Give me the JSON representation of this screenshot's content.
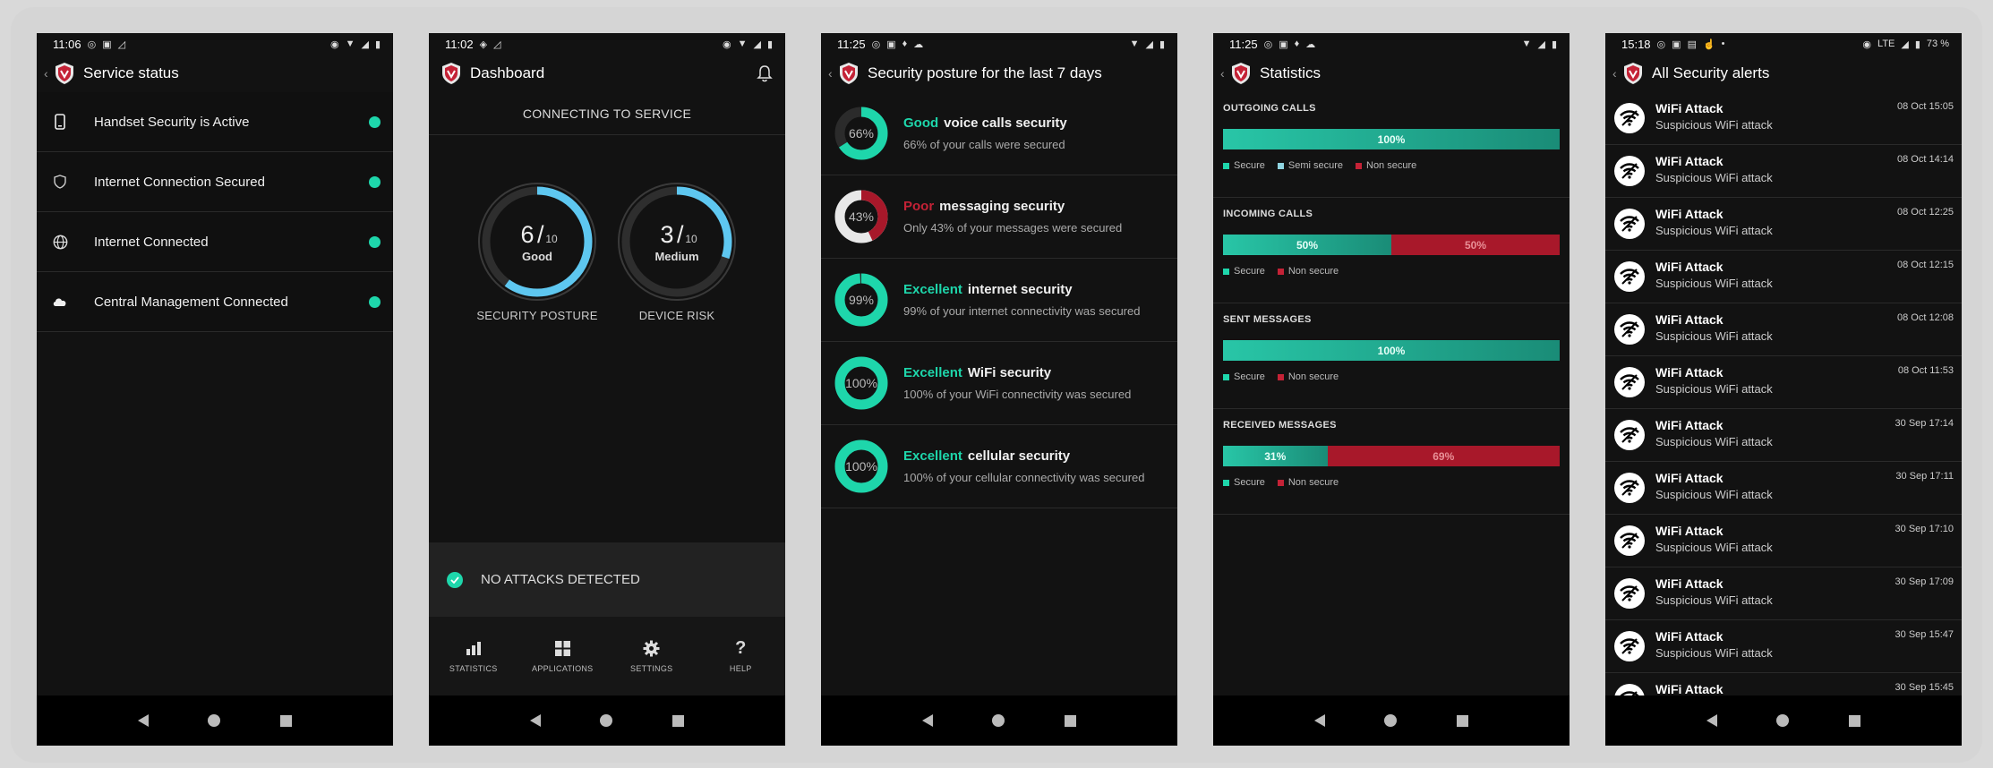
{
  "colors": {
    "accent": "#1ed6ab",
    "poor": "#a8182a",
    "ring_blue": "#5ec7f0"
  },
  "phones": [
    {
      "status": {
        "time": "11:06"
      },
      "title": "Service status",
      "items": [
        {
          "icon": "phone-icon",
          "label": "Handset Security is Active"
        },
        {
          "icon": "shield-icon",
          "label": "Internet Connection Secured"
        },
        {
          "icon": "globe-icon",
          "label": "Internet Connected"
        },
        {
          "icon": "cloud-icon",
          "label": "Central Management Connected"
        }
      ]
    },
    {
      "status": {
        "time": "11:02"
      },
      "title": "Dashboard",
      "connecting": "CONNECTING TO SERVICE",
      "gauges": [
        {
          "score": "6",
          "denom": "10",
          "rating": "Good",
          "label": "SECURITY POSTURE",
          "fraction": 0.6
        },
        {
          "score": "3",
          "denom": "10",
          "rating": "Medium",
          "label": "DEVICE RISK",
          "fraction": 0.3
        }
      ],
      "no_attacks": "NO ATTACKS DETECTED",
      "nav": [
        {
          "icon": "statistics-icon",
          "label": "STATISTICS"
        },
        {
          "icon": "applications-icon",
          "label": "APPLICATIONS"
        },
        {
          "icon": "settings-icon",
          "label": "SETTINGS"
        },
        {
          "icon": "help-icon",
          "label": "HELP",
          "glyph": "?"
        }
      ]
    },
    {
      "status": {
        "time": "11:25"
      },
      "title": "Security posture for the last 7 days",
      "rows": [
        {
          "pct": "66%",
          "value": 66,
          "rating": "Good",
          "rating_color": "#1ed6ab",
          "kind": "voice calls security",
          "sub": "66% of your calls were secured"
        },
        {
          "pct": "43%",
          "value": 43,
          "rating": "Poor",
          "rating_color": "#c42236",
          "kind": "messaging security",
          "sub": "Only 43% of your messages were secured"
        },
        {
          "pct": "99%",
          "value": 99,
          "rating": "Excellent",
          "rating_color": "#1ed6ab",
          "kind": "internet security",
          "sub": "99% of your internet connectivity was secured"
        },
        {
          "pct": "100%",
          "value": 100,
          "rating": "Excellent",
          "rating_color": "#1ed6ab",
          "kind": "WiFi security",
          "sub": "100% of your WiFi connectivity was secured"
        },
        {
          "pct": "100%",
          "value": 100,
          "rating": "Excellent",
          "rating_color": "#1ed6ab",
          "kind": "cellular security",
          "sub": "100% of your cellular connectivity was secured"
        }
      ]
    },
    {
      "status": {
        "time": "11:25"
      },
      "title": "Statistics",
      "sections": [
        {
          "title": "OUTGOING CALLS",
          "segments": [
            {
              "type": "sec",
              "value": 100,
              "label": "100%"
            }
          ],
          "legend": [
            {
              "label": "Secure",
              "color": "#1ed6ab"
            },
            {
              "label": "Semi secure",
              "color": "#8fd4e0"
            },
            {
              "label": "Non secure",
              "color": "#c42236"
            }
          ]
        },
        {
          "title": "INCOMING CALLS",
          "segments": [
            {
              "type": "sec",
              "value": 50,
              "label": "50%"
            },
            {
              "type": "non",
              "value": 50,
              "label": "50%"
            }
          ],
          "legend": [
            {
              "label": "Secure",
              "color": "#1ed6ab"
            },
            {
              "label": "Non secure",
              "color": "#c42236"
            }
          ]
        },
        {
          "title": "SENT MESSAGES",
          "segments": [
            {
              "type": "sec",
              "value": 100,
              "label": "100%"
            }
          ],
          "legend": [
            {
              "label": "Secure",
              "color": "#1ed6ab"
            },
            {
              "label": "Non secure",
              "color": "#c42236"
            }
          ]
        },
        {
          "title": "RECEIVED MESSAGES",
          "segments": [
            {
              "type": "sec",
              "value": 31,
              "label": "31%"
            },
            {
              "type": "non",
              "value": 69,
              "label": "69%"
            }
          ],
          "legend": [
            {
              "label": "Secure",
              "color": "#1ed6ab"
            },
            {
              "label": "Non secure",
              "color": "#c42236"
            }
          ]
        }
      ]
    },
    {
      "status": {
        "time": "15:18",
        "network": "LTE",
        "battery": "73 %"
      },
      "title": "All Security alerts",
      "alerts": [
        {
          "title": "WiFi Attack",
          "sub": "Suspicious WiFi attack",
          "time": "08 Oct 15:05"
        },
        {
          "title": "WiFi Attack",
          "sub": "Suspicious WiFi attack",
          "time": "08 Oct 14:14"
        },
        {
          "title": "WiFi Attack",
          "sub": "Suspicious WiFi attack",
          "time": "08 Oct 12:25"
        },
        {
          "title": "WiFi Attack",
          "sub": "Suspicious WiFi attack",
          "time": "08 Oct 12:15"
        },
        {
          "title": "WiFi Attack",
          "sub": "Suspicious WiFi attack",
          "time": "08 Oct 12:08"
        },
        {
          "title": "WiFi Attack",
          "sub": "Suspicious WiFi attack",
          "time": "08 Oct 11:53"
        },
        {
          "title": "WiFi Attack",
          "sub": "Suspicious WiFi attack",
          "time": "30 Sep 17:14"
        },
        {
          "title": "WiFi Attack",
          "sub": "Suspicious WiFi attack",
          "time": "30 Sep 17:11"
        },
        {
          "title": "WiFi Attack",
          "sub": "Suspicious WiFi attack",
          "time": "30 Sep 17:10"
        },
        {
          "title": "WiFi Attack",
          "sub": "Suspicious WiFi attack",
          "time": "30 Sep 17:09"
        },
        {
          "title": "WiFi Attack",
          "sub": "Suspicious WiFi attack",
          "time": "30 Sep 15:47"
        },
        {
          "title": "WiFi Attack",
          "sub": "",
          "time": "30 Sep 15:45"
        }
      ]
    }
  ]
}
